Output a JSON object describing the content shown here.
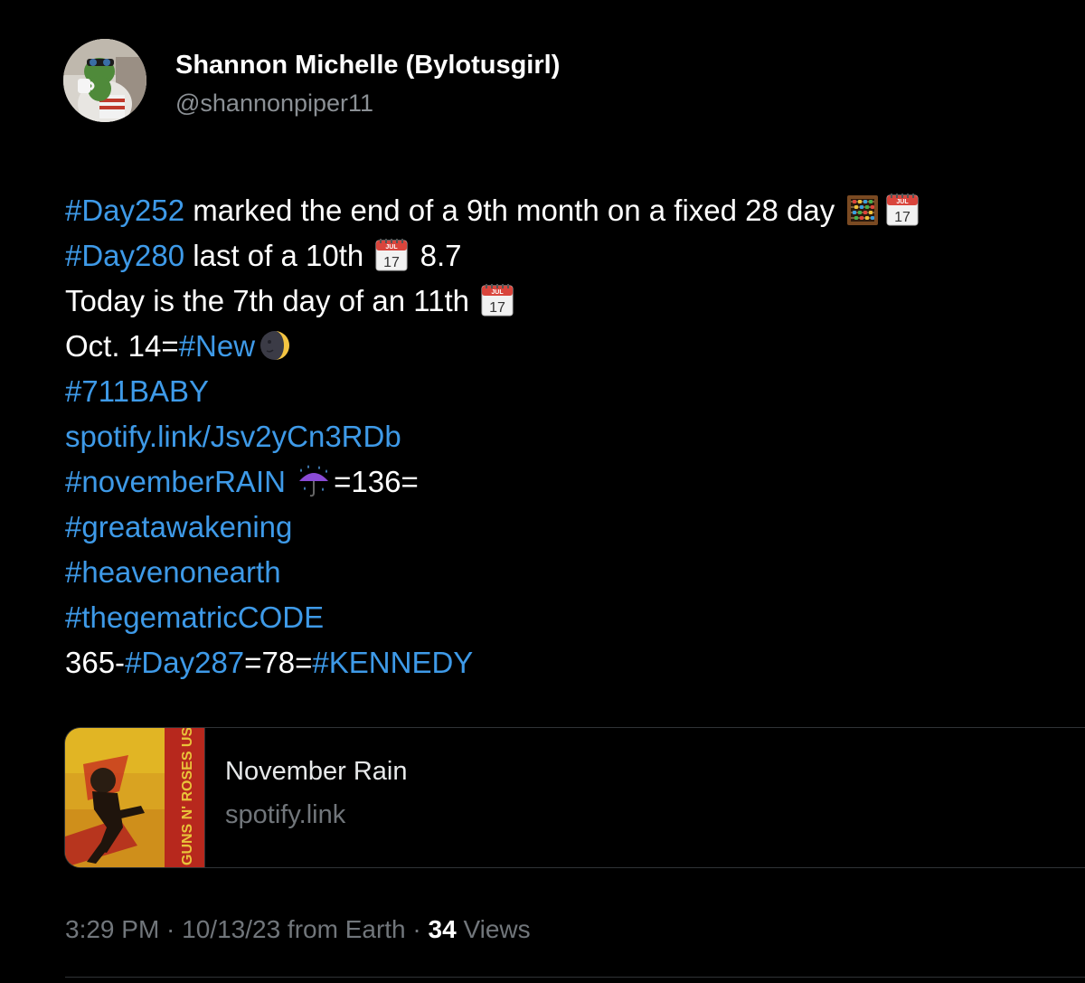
{
  "author": {
    "display_name": "Shannon Michelle (Bylotusgirl)",
    "handle": "@shannonpiper11"
  },
  "tweet": {
    "lines": [
      [
        {
          "t": "link",
          "v": "#Day252"
        },
        {
          "t": "text",
          "v": " marked the end of a 9th month on a fixed 28 day "
        },
        {
          "t": "emoji",
          "v": "abacus-icon"
        },
        {
          "t": "emoji",
          "v": "calendar-icon"
        }
      ],
      [
        {
          "t": "link",
          "v": "#Day280"
        },
        {
          "t": "text",
          "v": " last of a 10th "
        },
        {
          "t": "emoji",
          "v": "calendar-icon"
        },
        {
          "t": "text",
          "v": " 8.7"
        }
      ],
      [
        {
          "t": "text",
          "v": "Today is the 7th day of an 11th "
        },
        {
          "t": "emoji",
          "v": "calendar-icon"
        }
      ],
      [
        {
          "t": "text",
          "v": "Oct. 14="
        },
        {
          "t": "link",
          "v": "#New"
        },
        {
          "t": "emoji",
          "v": "new-moon-face-icon"
        }
      ],
      [
        {
          "t": "link",
          "v": "#711BABY"
        }
      ],
      [
        {
          "t": "link",
          "v": "spotify.link/Jsv2yCn3RDb"
        }
      ],
      [
        {
          "t": "link",
          "v": "#novemberRAIN"
        },
        {
          "t": "text",
          "v": " "
        },
        {
          "t": "emoji",
          "v": "umbrella-rain-icon"
        },
        {
          "t": "text",
          "v": "=136="
        }
      ],
      [
        {
          "t": "link",
          "v": "#greatawakening"
        }
      ],
      [
        {
          "t": "link",
          "v": "#heavenonearth"
        }
      ],
      [
        {
          "t": "link",
          "v": "#thegematricCODE"
        }
      ],
      [
        {
          "t": "text",
          "v": "365-"
        },
        {
          "t": "link",
          "v": "#Day287"
        },
        {
          "t": "text",
          "v": "=78="
        },
        {
          "t": "link",
          "v": "#KENNEDY"
        }
      ]
    ],
    "calendar_month": "JUL",
    "calendar_day": "17"
  },
  "card": {
    "title": "November Rain",
    "domain": "spotify.link",
    "album_side_text": "GUNS N' ROSES  USE YOUR ILLUSION I"
  },
  "meta": {
    "time_date": "3:29 PM · 10/13/23 from Earth · ",
    "views_count": "34",
    "views_label": " Views"
  },
  "colors": {
    "background": "#000000",
    "link": "#3e9ae8",
    "secondary_text": "#71767b",
    "divider": "#2f3336"
  }
}
